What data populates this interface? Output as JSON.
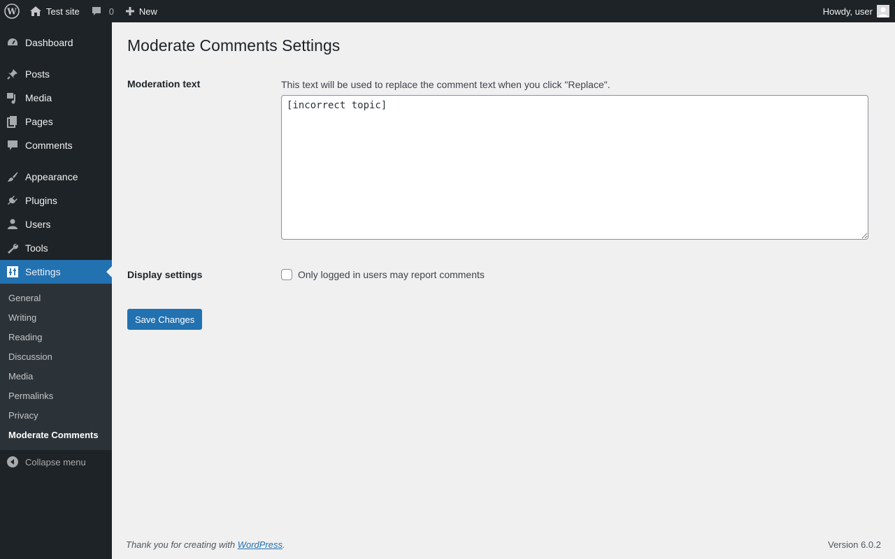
{
  "adminbar": {
    "site_name": "Test site",
    "comments_count": "0",
    "new_label": "New",
    "howdy": "Howdy, user"
  },
  "menu": {
    "items": [
      {
        "label": "Dashboard",
        "icon": "dashboard-icon"
      },
      {
        "label": "Posts",
        "icon": "pin-icon"
      },
      {
        "label": "Media",
        "icon": "media-icon"
      },
      {
        "label": "Pages",
        "icon": "pages-icon"
      },
      {
        "label": "Comments",
        "icon": "comment-icon"
      },
      {
        "label": "Appearance",
        "icon": "brush-icon"
      },
      {
        "label": "Plugins",
        "icon": "plugin-icon"
      },
      {
        "label": "Users",
        "icon": "user-icon"
      },
      {
        "label": "Tools",
        "icon": "wrench-icon"
      },
      {
        "label": "Settings",
        "icon": "settings-icon"
      }
    ],
    "current": "Settings",
    "submenu": [
      "General",
      "Writing",
      "Reading",
      "Discussion",
      "Media",
      "Permalinks",
      "Privacy",
      "Moderate Comments"
    ],
    "submenu_current": "Moderate Comments",
    "collapse_label": "Collapse menu"
  },
  "page": {
    "title": "Moderate Comments Settings",
    "moderation_label": "Moderation text",
    "moderation_desc": "This text will be used to replace the comment text when you click \"Replace\".",
    "moderation_value": "[incorrect topic]",
    "display_label": "Display settings",
    "report_checkbox_label": "Only logged in users may report comments",
    "report_checked": false,
    "save_label": "Save Changes"
  },
  "footer": {
    "thanks_prefix": "Thank you for creating with ",
    "wordpress_link": "WordPress",
    "thanks_suffix": ".",
    "version": "Version 6.0.2"
  },
  "colors": {
    "adminbar_bg": "#1d2327",
    "accent": "#2271b1",
    "content_bg": "#f0f0f1"
  }
}
